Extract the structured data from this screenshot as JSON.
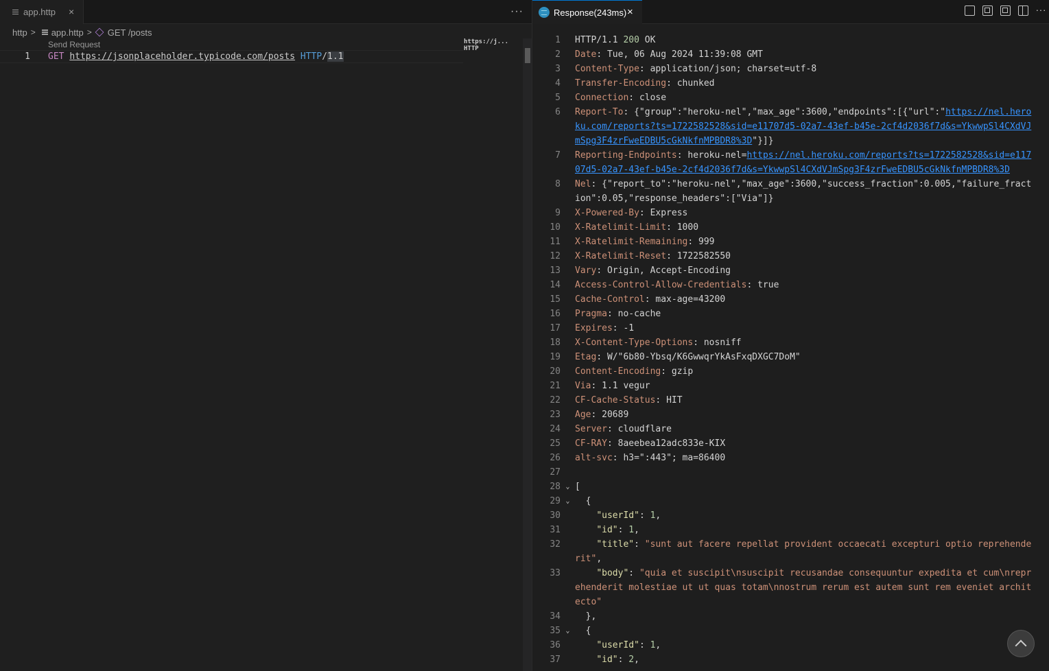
{
  "left_tab": {
    "label": "app.http",
    "close": "×"
  },
  "more": "···",
  "breadcrumb": {
    "root": "http",
    "file": "app.http",
    "symbol": "GET /posts"
  },
  "codelens": "Send Request",
  "editor": {
    "line_number": "1",
    "method": "GET",
    "url": "https://jsonplaceholder.typicode.com/posts",
    "protocol": "HTTP",
    "slash": "/",
    "version": "1.1"
  },
  "minimap": "https://j...  HTTP",
  "response_tab": {
    "label": "Response(243ms)",
    "close": "×"
  },
  "response_lines": [
    {
      "n": "1",
      "status_line": {
        "proto": "HTTP/1.1 ",
        "code": "200",
        "text": " OK"
      }
    },
    {
      "n": "2",
      "key": "Date",
      "value": "Tue, 06 Aug 2024 11:39:08 GMT"
    },
    {
      "n": "3",
      "key": "Content-Type",
      "value": "application/json; charset=utf-8"
    },
    {
      "n": "4",
      "key": "Transfer-Encoding",
      "value": "chunked"
    },
    {
      "n": "5",
      "key": "Connection",
      "value": "close"
    },
    {
      "n": "6",
      "key": "Report-To",
      "pre": "{\"group\":\"heroku-nel\",\"max_age\":3600,\"endpoints\":[{\"url\":\"",
      "link": "https://nel.heroku.com/reports?ts=1722582528&sid=e11707d5-02a7-43ef-b45e-2cf4d2036f7d&s=YkwwpSl4CXdVJmSpg3F4zrFweEDBU5cGkNkfnMPBDR8%3D",
      "post": "\"}]}"
    },
    {
      "n": "7",
      "key": "Reporting-Endpoints",
      "pre": "heroku-nel=",
      "link": "https://nel.heroku.com/reports?ts=1722582528&sid=e11707d5-02a7-43ef-b45e-2cf4d2036f7d&s=YkwwpSl4CXdVJmSpg3F4zrFweEDBU5cGkNkfnMPBDR8%3D",
      "post": ""
    },
    {
      "n": "8",
      "key": "Nel",
      "value": "{\"report_to\":\"heroku-nel\",\"max_age\":3600,\"success_fraction\":0.005,\"failure_fraction\":0.05,\"response_headers\":[\"Via\"]}"
    },
    {
      "n": "9",
      "key": "X-Powered-By",
      "value": "Express"
    },
    {
      "n": "10",
      "key": "X-Ratelimit-Limit",
      "value": "1000"
    },
    {
      "n": "11",
      "key": "X-Ratelimit-Remaining",
      "value": "999"
    },
    {
      "n": "12",
      "key": "X-Ratelimit-Reset",
      "value": "1722582550"
    },
    {
      "n": "13",
      "key": "Vary",
      "value": "Origin, Accept-Encoding"
    },
    {
      "n": "14",
      "key": "Access-Control-Allow-Credentials",
      "value": "true"
    },
    {
      "n": "15",
      "key": "Cache-Control",
      "value": "max-age=43200"
    },
    {
      "n": "16",
      "key": "Pragma",
      "value": "no-cache"
    },
    {
      "n": "17",
      "key": "Expires",
      "value": "-1"
    },
    {
      "n": "18",
      "key": "X-Content-Type-Options",
      "value": "nosniff"
    },
    {
      "n": "19",
      "key": "Etag",
      "value": "W/\"6b80-Ybsq/K6GwwqrYkAsFxqDXGC7DoM\""
    },
    {
      "n": "20",
      "key": "Content-Encoding",
      "value": "gzip"
    },
    {
      "n": "21",
      "key": "Via",
      "value": "1.1 vegur"
    },
    {
      "n": "22",
      "key": "CF-Cache-Status",
      "value": "HIT"
    },
    {
      "n": "23",
      "key": "Age",
      "value": "20689"
    },
    {
      "n": "24",
      "key": "Server",
      "value": "cloudflare"
    },
    {
      "n": "25",
      "key": "CF-RAY",
      "value": "8aeebea12adc833e-KIX"
    },
    {
      "n": "26",
      "key": "alt-svc",
      "value": "h3=\":443\"; ma=86400"
    },
    {
      "n": "27",
      "raw": ""
    },
    {
      "n": "28",
      "fold": true,
      "raw": "["
    },
    {
      "n": "29",
      "fold": true,
      "raw": "  {"
    },
    {
      "n": "30",
      "jkey": "\"userId\"",
      "jnum": "1",
      "indent": "    "
    },
    {
      "n": "31",
      "jkey": "\"id\"",
      "jnum": "1",
      "indent": "    "
    },
    {
      "n": "32",
      "jkey": "\"title\"",
      "jstr": "\"sunt aut facere repellat provident occaecati excepturi optio reprehenderit\"",
      "indent": "    "
    },
    {
      "n": "33",
      "jkey": "\"body\"",
      "jstr": "\"quia et suscipit\\nsuscipit recusandae consequuntur expedita et cum\\nreprehenderit molestiae ut ut quas totam\\nnostrum rerum est autem sunt rem eveniet architecto\"",
      "indent": "    ",
      "nocomma": true
    },
    {
      "n": "34",
      "raw": "  },"
    },
    {
      "n": "35",
      "fold": true,
      "raw": "  {"
    },
    {
      "n": "36",
      "jkey": "\"userId\"",
      "jnum": "1",
      "indent": "    "
    },
    {
      "n": "37",
      "jkey": "\"id\"",
      "jnum": "2",
      "indent": "    "
    }
  ],
  "icons": {
    "save": "save-icon",
    "open-preview": "preview-icon",
    "copy": "copy-icon",
    "split": "split-editor-icon",
    "more": "more-icon",
    "scroll_top": "chevron-up-icon"
  }
}
